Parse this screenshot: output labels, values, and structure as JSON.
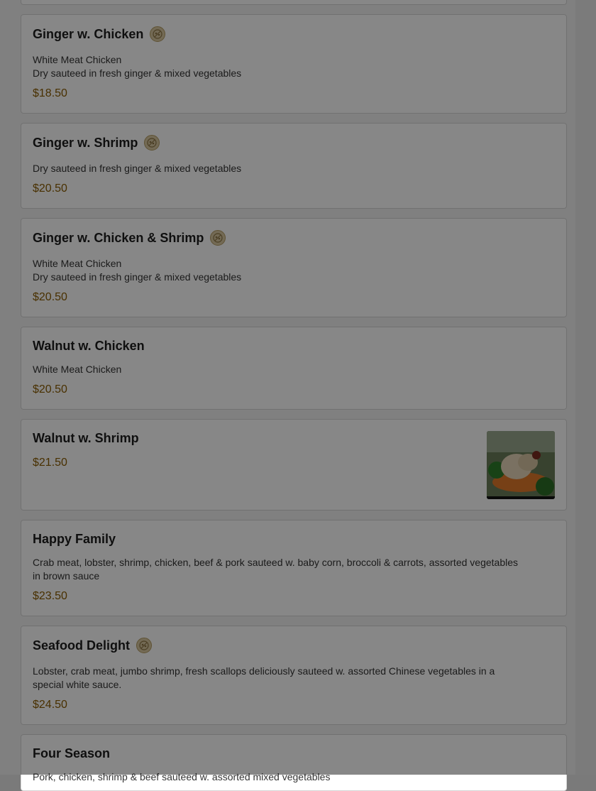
{
  "menu": {
    "items": [
      {
        "name": "Ginger w. Chicken",
        "spicy": true,
        "desc_line1": "White Meat Chicken",
        "desc_line2": "Dry sauteed in fresh ginger & mixed vegetables",
        "price": "$18.50"
      },
      {
        "name": "Ginger w. Shrimp",
        "spicy": true,
        "desc_line1": "Dry sauteed in fresh ginger & mixed vegetables",
        "price": "$20.50"
      },
      {
        "name": "Ginger w. Chicken & Shrimp",
        "spicy": true,
        "desc_line1": "White Meat Chicken",
        "desc_line2": "Dry sauteed in fresh ginger & mixed vegetables",
        "price": "$20.50"
      },
      {
        "name": "Walnut w. Chicken",
        "desc_line1": "White Meat Chicken",
        "price": "$20.50"
      },
      {
        "name": "Walnut w. Shrimp",
        "price": "$21.50",
        "image": "walnut-shrimp-photo"
      },
      {
        "name": "Happy Family",
        "desc_line1": "Crab meat, lobster, shrimp, chicken, beef & pork sauteed w. baby corn, broccoli & carrots, assorted vegetables in brown sauce",
        "price": "$23.50"
      },
      {
        "name": "Seafood Delight",
        "spicy": true,
        "desc_line1": "Lobster, crab meat, jumbo shrimp, fresh scallops deliciously sauteed w. assorted Chinese vegetables in a special white sauce.",
        "price": "$24.50"
      },
      {
        "name": "Four Season",
        "desc_line1": "Pork, chicken, shrimp & beef sauteed w. assorted mixed vegetables"
      }
    ]
  },
  "colors": {
    "price": "#8a5c00",
    "badge": "#d9c9a0",
    "overlay": "rgba(0,0,0,0.47)"
  },
  "icons": {
    "badge": "spicy-badge-icon"
  }
}
